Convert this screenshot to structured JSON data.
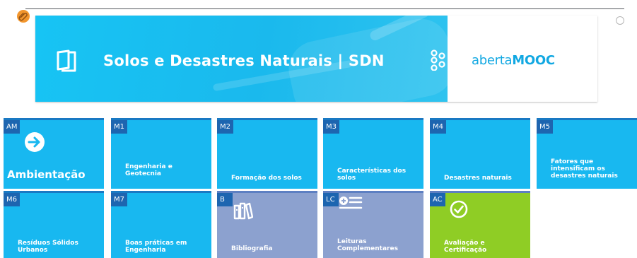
{
  "banner": {
    "title": "Solos e Desastres Naturais | SDN",
    "brand_light": "aberta",
    "brand_bold": "MOOC"
  },
  "tiles": [
    {
      "badge": "AM",
      "label": "Ambientação",
      "icon": "arrow-right-circle-icon"
    },
    {
      "badge": "M1",
      "label": "Engenharia e Geotecnia"
    },
    {
      "badge": "M2",
      "label": "Formação dos solos"
    },
    {
      "badge": "M3",
      "label": "Características dos solos"
    },
    {
      "badge": "M4",
      "label": "Desastres naturais"
    },
    {
      "badge": "M5",
      "label": "Fatores que intensificam os desastres naturais"
    },
    {
      "badge": "M6",
      "label": "Resíduos Sólidos Urbanos"
    },
    {
      "badge": "M7",
      "label": "Boas práticas em Engenharia"
    },
    {
      "badge": "B",
      "label": "Bibliografia",
      "icon": "books-icon"
    },
    {
      "badge": "LC",
      "label": "Leituras Complementares",
      "icon": "add-list-icon"
    },
    {
      "badge": "AC",
      "label": "Avaliação e Certificação",
      "icon": "check-circle-icon"
    }
  ],
  "colors": {
    "tile_blue": "#18b8f0",
    "tile_purple": "#8ca1cf",
    "tile_green": "#8fcd25",
    "badge": "#1d65b0",
    "brand": "#12a8e2"
  }
}
